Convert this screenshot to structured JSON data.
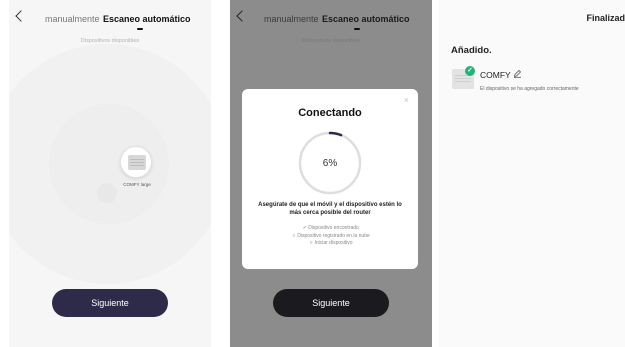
{
  "panels": {
    "search": {
      "tab_manual": "manualmente",
      "tab_auto": "Escaneo automático",
      "subtitle": "Dispositivos disponibles",
      "device_name": "COMFY large",
      "next_button": "Siguiente"
    },
    "connecting": {
      "tab_manual": "manualmente",
      "tab_auto": "Escaneo automático",
      "subtitle": "Dispositivos disponibles",
      "modal": {
        "close": "×",
        "title": "Conectando",
        "progress_text": "6%",
        "progress": 0.06,
        "message": "Asegúrate de que el móvil y el dispositivo estén lo más cerca posible del router",
        "steps": [
          {
            "mark": "✓",
            "label": "Dispositivo encontrado"
          },
          {
            "mark": "○",
            "label": "Dispositivo registrado en la nube"
          },
          {
            "mark": "○",
            "label": "Iniciar dispositivo"
          }
        ]
      },
      "next_button": "Siguiente"
    },
    "added": {
      "finalize": "Finalizad",
      "heading": "Añadido.",
      "device_name": "COMFY",
      "message": "El dispositivo se ha agregado correctamente"
    }
  },
  "colors": {
    "accent_button": "#2e2a4a",
    "success": "#23b37a",
    "progress": "#2e2a4a"
  },
  "icons": {
    "back": "chevron-left-icon",
    "close": "close-icon",
    "check": "check-icon",
    "edit": "pencil-icon"
  }
}
